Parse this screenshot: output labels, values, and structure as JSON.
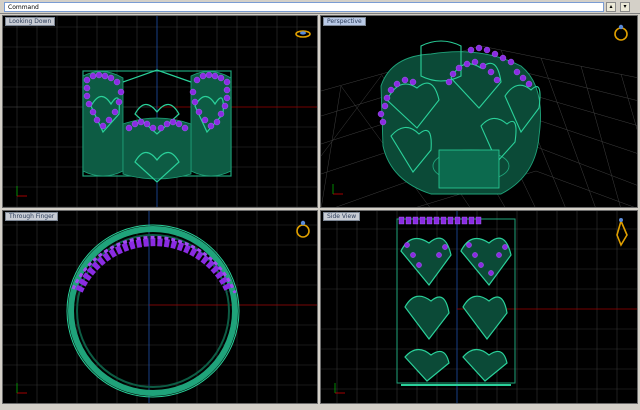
{
  "command_bar": {
    "label": "Command",
    "buttons": [
      "▴",
      "▾"
    ]
  },
  "viewports": [
    {
      "id": "top",
      "title": "Looking Down"
    },
    {
      "id": "persp",
      "title": "Perspective"
    },
    {
      "id": "front",
      "title": "Through Finger"
    },
    {
      "id": "side",
      "title": "Side View"
    }
  ],
  "colors": {
    "background": "#000000",
    "grid": "#3a3a3a",
    "grid_major": "#5a5a5a",
    "axis_x": "#a00000",
    "axis_y": "#0050c8",
    "ring_green": "#1fa37a",
    "gems_purple": "#8a2be2",
    "gold": "#e0a000"
  }
}
